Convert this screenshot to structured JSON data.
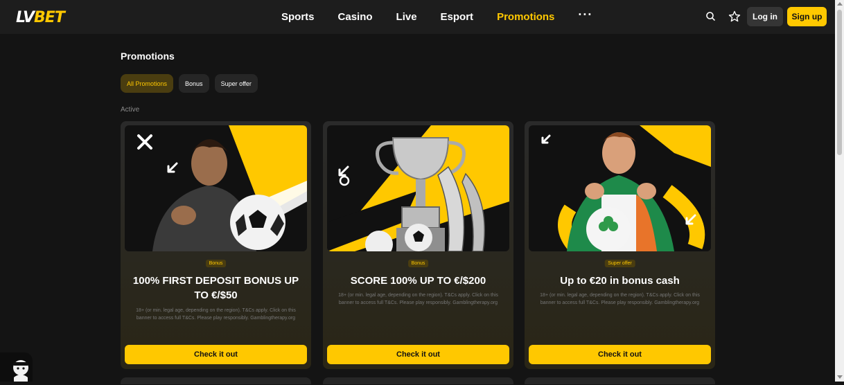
{
  "header": {
    "logo_left": "LV",
    "logo_right": "BET",
    "nav": [
      "Sports",
      "Casino",
      "Live",
      "Esport",
      "Promotions"
    ],
    "nav_active": "Promotions",
    "more_label": "···",
    "login_label": "Log in",
    "signup_label": "Sign up",
    "icons": [
      "search-icon",
      "star-icon"
    ]
  },
  "page": {
    "title": "Promotions",
    "filters": [
      "All Promotions",
      "Bonus",
      "Super offer"
    ],
    "active_filter": "All Promotions",
    "section_label": "Active"
  },
  "cards": [
    {
      "badge": "Bonus",
      "title": "100% FIRST DEPOSIT BONUS UP TO €/$50",
      "terms": "18+ (or min. legal age, depending on the region). T&Cs apply. Click on this banner to access full T&Cs. Please play responsibly. Gamblingtherapy.org",
      "button": "Check it out"
    },
    {
      "badge": "Bonus",
      "title": "SCORE 100% UP TO €/$200",
      "terms": "18+ (or min. legal age, depending on the region). T&Cs apply. Click on this banner to access full T&Cs. Please play responsibly. Gamblingtherapy.org",
      "button": "Check it out"
    },
    {
      "badge": "Super offer",
      "title": "Up to €20 in bonus cash",
      "terms": "18+ (or min. legal age, depending on the region). T&Cs apply. Click on this banner to access full T&Cs. Please play responsibly. Gamblingtherapy.org",
      "button": "Check it out"
    }
  ],
  "colors": {
    "accent": "#ffc800",
    "background": "#141414",
    "header": "#1d1d1d",
    "card": "#2a2a2a"
  }
}
